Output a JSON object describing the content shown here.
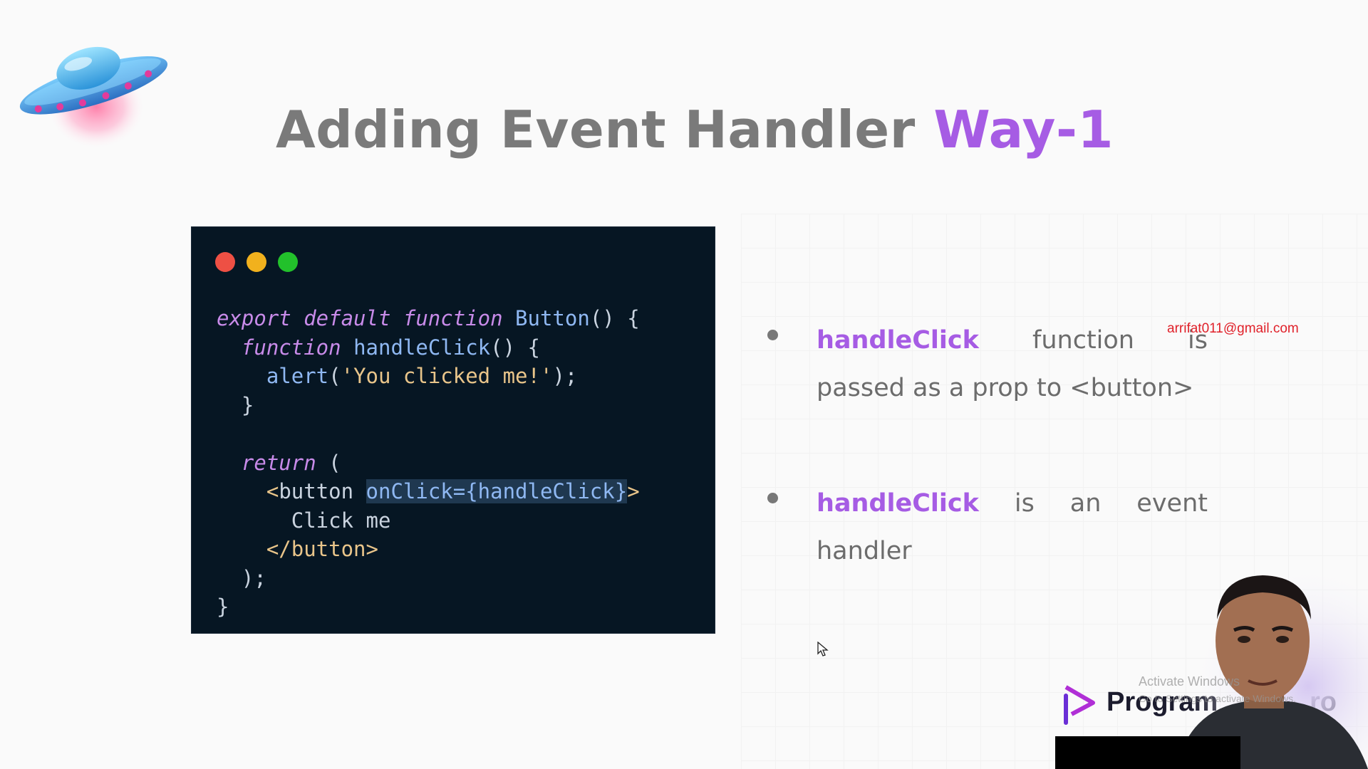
{
  "slide": {
    "title_main": "Adding Event Handler",
    "title_accent": "Way-1",
    "accent_color": "#a65ce4",
    "logo_icon": "ufo-icon"
  },
  "code_window": {
    "lines": [
      [
        {
          "t": "export default function",
          "c": "kw"
        },
        {
          "t": " "
        },
        {
          "t": "Button",
          "c": "fn"
        },
        {
          "t": "() {"
        }
      ],
      [
        {
          "t": "  "
        },
        {
          "t": "function",
          "c": "kw"
        },
        {
          "t": " "
        },
        {
          "t": "handleClick",
          "c": "fn"
        },
        {
          "t": "() {"
        }
      ],
      [
        {
          "t": "    "
        },
        {
          "t": "alert",
          "c": "fn"
        },
        {
          "t": "("
        },
        {
          "t": "'You clicked me!'",
          "c": "str"
        },
        {
          "t": ");"
        }
      ],
      [
        {
          "t": "  }"
        }
      ],
      [
        {
          "t": ""
        }
      ],
      [
        {
          "t": "  "
        },
        {
          "t": "return",
          "c": "kw"
        },
        {
          "t": " ("
        }
      ],
      [
        {
          "t": "    "
        },
        {
          "t": "<",
          "c": "tag"
        },
        {
          "t": "button "
        },
        {
          "t": "onClick={handleClick}",
          "c": "hl"
        },
        {
          "t": ">",
          "c": "tag"
        }
      ],
      [
        {
          "t": "      Click me"
        }
      ],
      [
        {
          "t": "    "
        },
        {
          "t": "</button>",
          "c": "tag"
        }
      ],
      [
        {
          "t": "  );"
        }
      ],
      [
        {
          "t": "}"
        }
      ]
    ]
  },
  "bullets": [
    {
      "keyword": "handleClick",
      "text": " function is passed as a prop to <button>"
    },
    {
      "keyword": "handleClick",
      "text": " is an event handler"
    }
  ],
  "overlay": {
    "email": "arrifat011@gmail.com",
    "watermark_line1": "Activate Windows",
    "watermark_line2": "Go to Settings to activate Windows.",
    "brand_part1": "Program",
    "brand_part2": "ro"
  }
}
